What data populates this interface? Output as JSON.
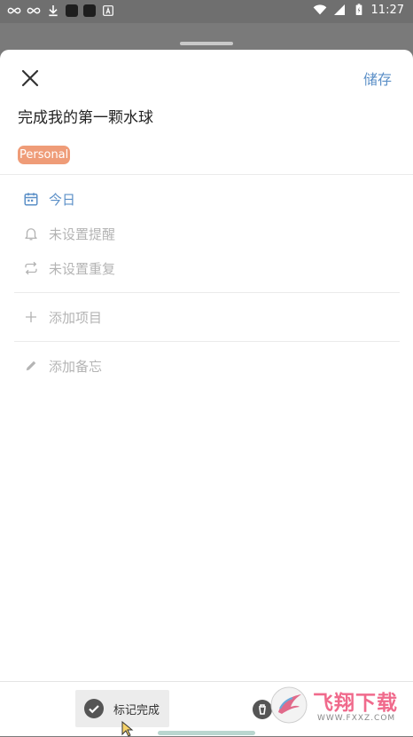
{
  "status_bar": {
    "time": "11:27"
  },
  "header": {
    "save_label": "储存"
  },
  "task": {
    "title": "完成我的第一颗水球",
    "tag": "Personal",
    "tag_color": "#ef9c78"
  },
  "options": [
    {
      "label": "今日",
      "icon": "calendar-icon",
      "active": true
    },
    {
      "label": "未设置提醒",
      "icon": "bell-icon",
      "active": false
    },
    {
      "label": "未设置重复",
      "icon": "repeat-icon",
      "active": false
    }
  ],
  "add_item": {
    "label": "添加项目",
    "icon": "plus-icon"
  },
  "add_note": {
    "label": "添加备忘",
    "icon": "pencil-icon"
  },
  "bottom": {
    "complete_label": "标记完成"
  },
  "watermark": {
    "text": "飞翔下载",
    "url": "WWW.FXXZ.COM"
  },
  "colors": {
    "accent": "#5b8fc7",
    "muted": "#b4b4b4",
    "background_dim": "#7a7a7a"
  }
}
